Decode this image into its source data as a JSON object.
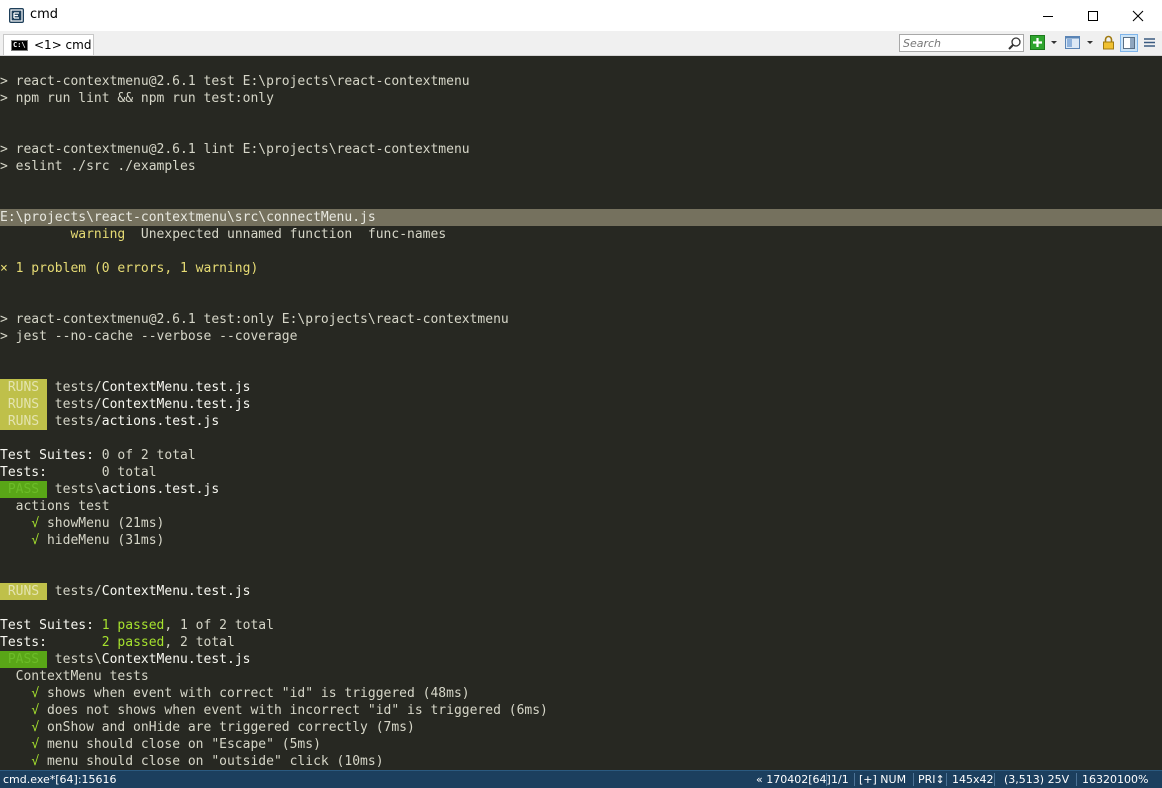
{
  "window": {
    "title": "cmd",
    "minimize_icon": "minimize-icon",
    "maximize_icon": "maximize-icon",
    "close_icon": "close-icon"
  },
  "tabbar": {
    "tab_label": "<1> cmd",
    "tab_icon_text": "C:\\",
    "search_placeholder": "Search"
  },
  "console": {
    "lines": [
      {
        "text": "> react-contextmenu@2.6.1 test E:\\projects\\react-contextmenu"
      },
      {
        "text": "> npm run lint && npm run test:only"
      },
      {
        "text": "> react-contextmenu@2.6.1 lint E:\\projects\\react-contextmenu"
      },
      {
        "text": "> eslint ./src ./examples"
      },
      {
        "text": "E:\\projects\\react-contextmenu\\src\\connectMenu.js"
      },
      {
        "level": "warning",
        "message": "Unexpected unnamed function",
        "rule": "func-names"
      },
      {
        "text": "× 1 problem (0 errors, 1 warning)"
      },
      {
        "text": "> react-contextmenu@2.6.1 test:only E:\\projects\\react-contextmenu"
      },
      {
        "text": "> jest --no-cache --verbose --coverage"
      }
    ],
    "runs_badge": " RUNS ",
    "pass_badge": " PASS ",
    "runs_block_1": [
      {
        "dir": "tests/",
        "file": "ContextMenu.test.js"
      },
      {
        "dir": "tests/",
        "file": "ContextMenu.test.js"
      },
      {
        "dir": "tests/",
        "file": "actions.test.js"
      }
    ],
    "summary_1": {
      "suites_label": "Test Suites:",
      "suites_value": "0 of 2 total",
      "tests_label": "Tests:",
      "tests_value": "0 total"
    },
    "pass_1": {
      "dir": "tests\\",
      "file": "actions.test.js"
    },
    "group_1": {
      "name": "actions test",
      "tests": [
        {
          "check": "√",
          "name": "showMenu (21ms)"
        },
        {
          "check": "√",
          "name": "hideMenu (31ms)"
        }
      ]
    },
    "runs_block_2": {
      "dir": "tests/",
      "file": "ContextMenu.test.js"
    },
    "summary_2": {
      "suites_label": "Test Suites:",
      "suites_passed": "1 passed",
      "suites_rest": ", 1 of 2 total",
      "tests_label": "Tests:",
      "tests_passed": "2 passed",
      "tests_rest": ", 2 total"
    },
    "pass_2": {
      "dir": "tests\\",
      "file": "ContextMenu.test.js"
    },
    "group_2": {
      "name": "ContextMenu tests",
      "tests": [
        {
          "check": "√",
          "name": "shows when event with correct \"id\" is triggered (48ms)"
        },
        {
          "check": "√",
          "name": "does not shows when event with incorrect \"id\" is triggered (6ms)"
        },
        {
          "check": "√",
          "name": "onShow and onHide are triggered correctly (7ms)"
        },
        {
          "check": "√",
          "name": "menu should close on \"Escape\" (5ms)"
        },
        {
          "check": "√",
          "name": "menu should close on \"outside\" click (10ms)"
        }
      ]
    }
  },
  "statusbar": {
    "process": "cmd.exe*[64]:15616",
    "build": "« 170402[64]",
    "tabs": "1/1",
    "mode": "[+] NUM",
    "priority": "PRI↕",
    "size": "145x42",
    "cursor": "(3,513) 25V",
    "pid": "16320",
    "zoom": "100%"
  },
  "colors": {
    "console_bg": "#272822",
    "highlight_bg": "#75715e",
    "runs_badge_bg": "#bfc04a",
    "pass_badge_bg": "#59a617",
    "warning": "#e6db74",
    "passed": "#a6e22e",
    "statusbar_bg": "#1c3f5e"
  }
}
